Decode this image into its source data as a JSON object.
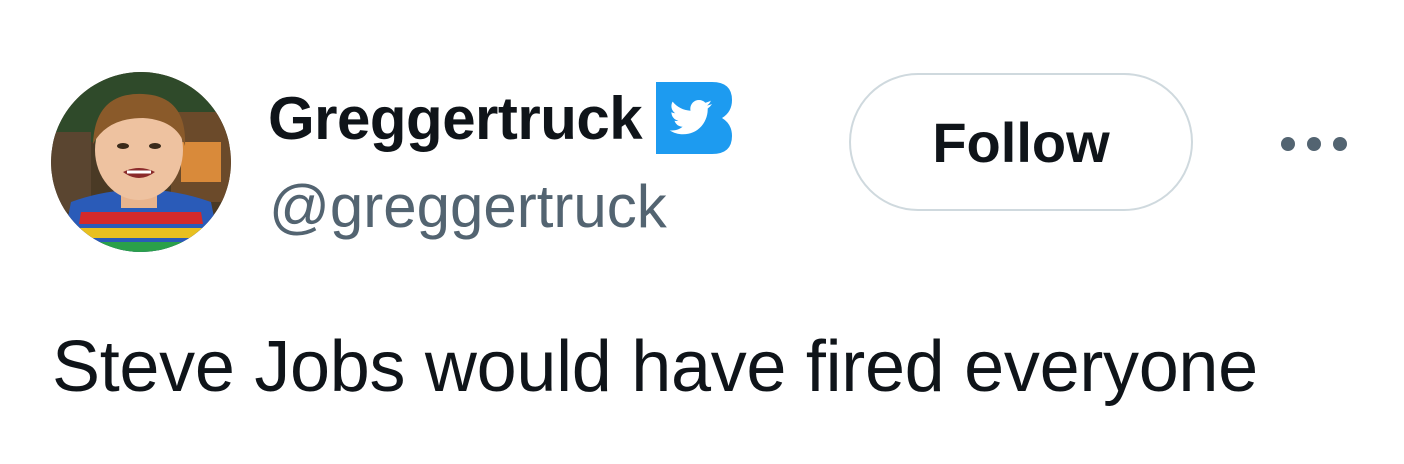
{
  "author": {
    "display_name": "Greggertruck",
    "handle": "@greggertruck",
    "avatar_icon": "child-portrait-avatar",
    "verified_icon": "twitter-bird-verified-badge"
  },
  "actions": {
    "follow_label": "Follow",
    "more_icon": "more-horizontal-icon"
  },
  "tweet": {
    "text": "Steve Jobs would have fired everyone"
  },
  "colors": {
    "text_primary": "#0f1419",
    "text_secondary": "#536471",
    "button_border": "#cfd9de",
    "badge_blue": "#1d9bf0"
  }
}
